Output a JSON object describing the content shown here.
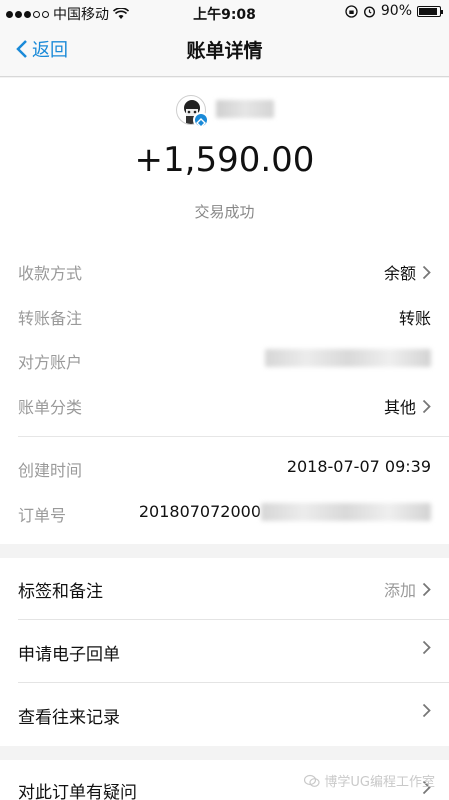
{
  "status_bar": {
    "carrier": "中国移动",
    "time": "上午9:08",
    "battery_text": "90%",
    "battery_level": 0.9
  },
  "nav": {
    "back_label": "返回",
    "title": "账单详情"
  },
  "header": {
    "amount": "+1,590.00",
    "status": "交易成功"
  },
  "details": {
    "rows": [
      {
        "label": "收款方式",
        "value": "余额"
      },
      {
        "label": "转账备注",
        "value": "转账"
      },
      {
        "label": "对方账户",
        "value": ""
      },
      {
        "label": "账单分类",
        "value": "其他"
      },
      {
        "label": "创建时间",
        "value": "2018-07-07 09:39"
      },
      {
        "label": "订单号",
        "value": "201807072000"
      }
    ]
  },
  "actions": {
    "tags": {
      "label": "标签和备注",
      "hint": "添加"
    },
    "receipt": {
      "label": "申请电子回单"
    },
    "history": {
      "label": "查看往来记录"
    },
    "question": {
      "label": "对此订单有疑问"
    }
  },
  "watermark": "博学UG编程工作室"
}
